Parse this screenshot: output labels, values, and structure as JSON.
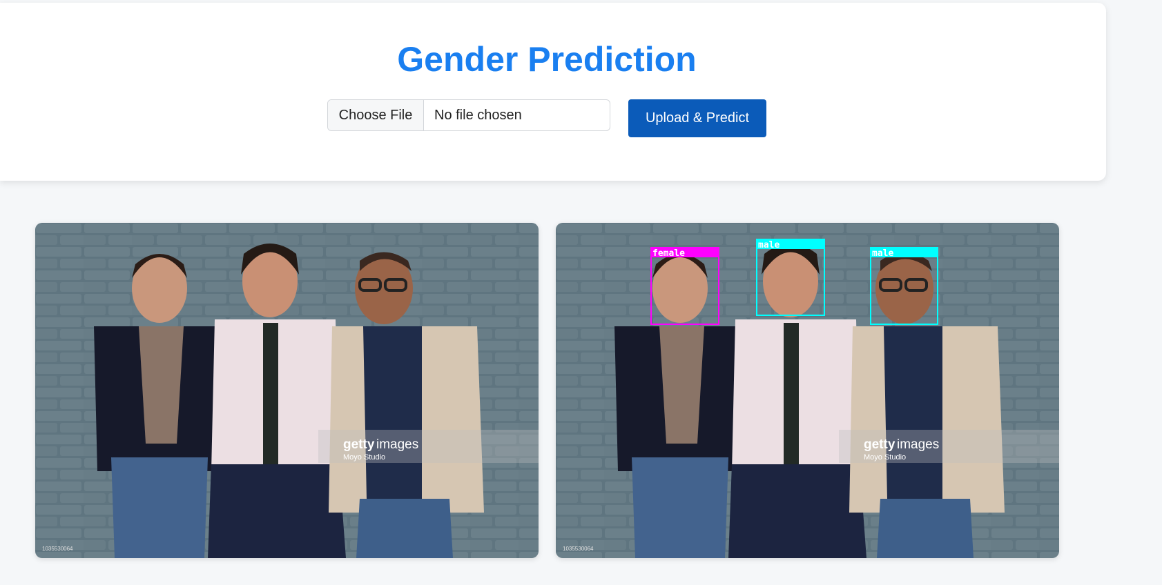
{
  "header": {
    "title": "Gender Prediction"
  },
  "upload_form": {
    "choose_file_label": "Choose File",
    "file_status": "No file chosen",
    "submit_label": "Upload & Predict"
  },
  "images": {
    "watermark_brand_a": "getty",
    "watermark_brand_b": "images",
    "watermark_credit": "Moyo Studio",
    "image_id": "1035530064"
  },
  "detections": [
    {
      "label": "female",
      "color": "#ff00ff"
    },
    {
      "label": "male",
      "color": "#00ffff"
    },
    {
      "label": "male",
      "color": "#00ffff"
    }
  ],
  "colors": {
    "accent": "#1a7ff0",
    "button": "#0b5bb9",
    "page_background": "#f5f7f9"
  }
}
